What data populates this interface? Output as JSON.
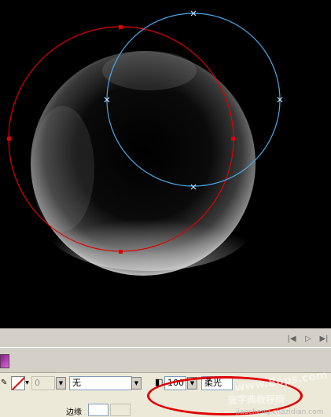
{
  "props": {
    "stroke_size": "0",
    "fill_style": "无",
    "alpha": "100",
    "blend": "柔光",
    "bottom_label": "边缘"
  },
  "watermark": {
    "site": "www.86ps.com",
    "site2": "jiaocheng.chazidian.com",
    "brand": "查字典教程网"
  },
  "icons": {
    "nav_first": "skip-back-icon",
    "nav_play": "play-icon",
    "nav_last": "skip-forward-icon",
    "stroke_color": "stroke-swatch-icon",
    "alpha_icon": "alpha-icon"
  },
  "colors": {
    "red_path": "#e00000",
    "blue_path": "#4aa8e8"
  }
}
